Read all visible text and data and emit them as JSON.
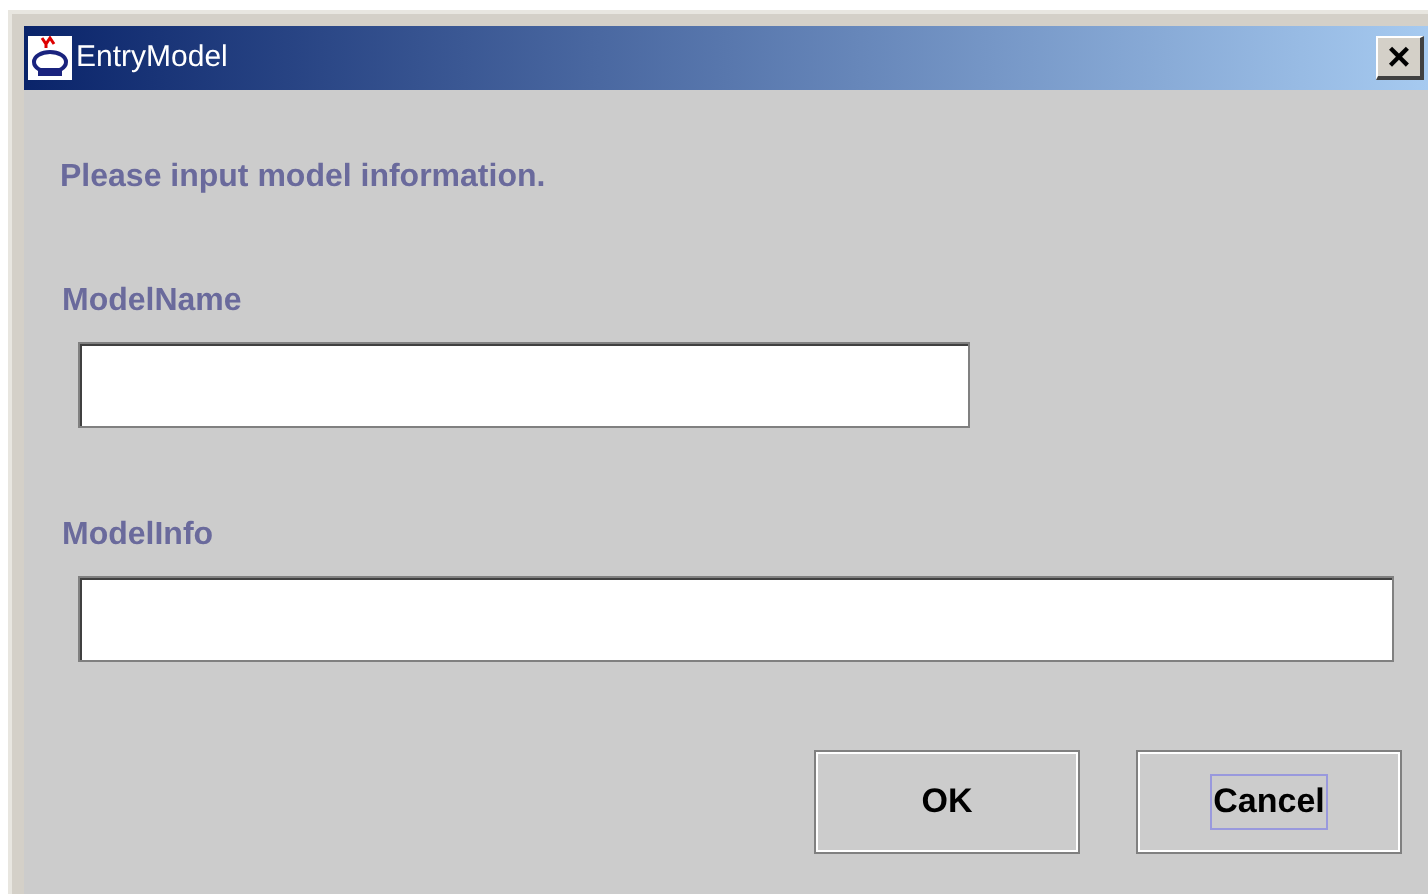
{
  "window": {
    "title": "EntryModel",
    "close": "×"
  },
  "prompt": "Please input model information.",
  "fields": [
    {
      "label": "ModelName",
      "wide": false
    },
    {
      "label": "ModelInfo",
      "wide": true
    }
  ],
  "buttons": [
    {
      "label": "OK",
      "focused": false
    },
    {
      "label": "Cancel",
      "focused": true
    }
  ]
}
